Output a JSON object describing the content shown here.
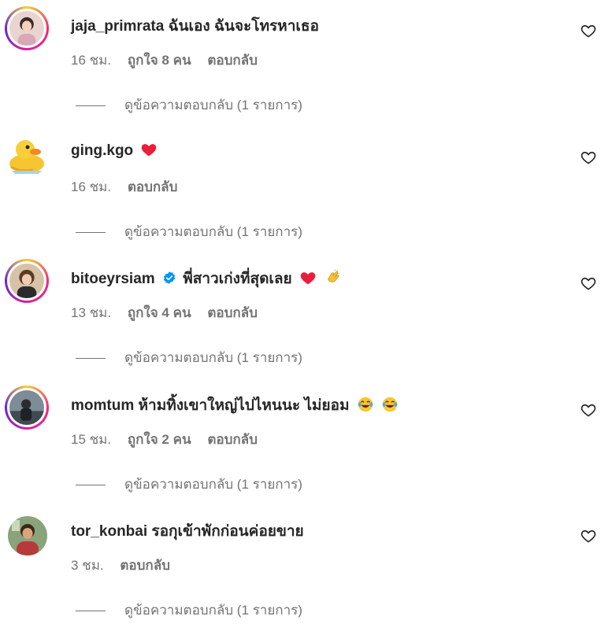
{
  "comments": [
    {
      "username": "jaja_primrata",
      "text": "ฉันเอง ฉันจะโทรหาเธอ",
      "time": "16 ชม.",
      "likes": "ถูกใจ 8 คน",
      "reply": "ตอบกลับ",
      "view_replies": "ดูข้อความตอบกลับ (1 รายการ)",
      "avatar_ring": true,
      "emojis": []
    },
    {
      "username": "ging.kgo",
      "text": "",
      "time": "16 ชม.",
      "likes": "",
      "reply": "ตอบกลับ",
      "view_replies": "ดูข้อความตอบกลับ (1 รายการ)",
      "avatar_ring": false,
      "emojis": [
        "red-heart"
      ]
    },
    {
      "username": "bitoeyrsiam",
      "verified": true,
      "text": "พี่สาวเก่งที่สุดเลย",
      "time": "13 ชม.",
      "likes": "ถูกใจ 4 คน",
      "reply": "ตอบกลับ",
      "view_replies": "ดูข้อความตอบกลับ (1 รายการ)",
      "avatar_ring": true,
      "emojis": [
        "red-heart",
        "clapping-hands"
      ]
    },
    {
      "username": "momtum",
      "text": "ห้ามทิ้งเขาใหญ่ไปไหนนะ ไม่ยอม",
      "time": "15 ชม.",
      "likes": "ถูกใจ 2 คน",
      "reply": "ตอบกลับ",
      "view_replies": "ดูข้อความตอบกลับ (1 รายการ)",
      "avatar_ring": true,
      "emojis": [
        "tears-of-joy",
        "tears-of-joy"
      ]
    },
    {
      "username": "tor_konbai",
      "text": "รอกุเข้าพักก่อนค่อยขาย",
      "time": "3 ชม.",
      "likes": "",
      "reply": "ตอบกลับ",
      "view_replies": "ดูข้อความตอบกลับ (1 รายการ)",
      "avatar_ring": false,
      "emojis": []
    }
  ],
  "icons": {
    "like": "heart-outline-icon",
    "verified": "verified-badge-icon"
  },
  "colors": {
    "text": "#262626",
    "secondary": "#737373",
    "verified": "#0095f6",
    "heart": "#ed4956"
  }
}
